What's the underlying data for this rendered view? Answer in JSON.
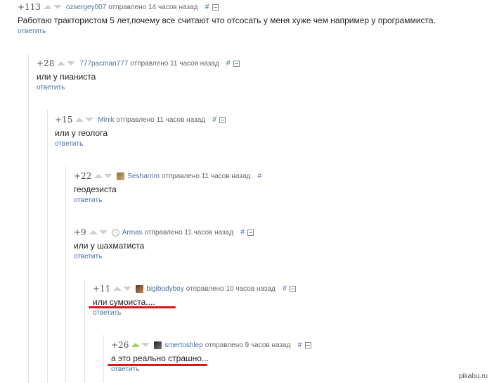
{
  "comments": [
    {
      "score": "+113",
      "author": "ozsergey007",
      "sent": "отправлено 14 часов назад",
      "hash": "#",
      "text": "Работаю трактористом 5 лет,почему все считают что отсосать у меня хуже чем например у программиста.",
      "reply": "ответить"
    },
    {
      "score": "+28",
      "author": "777pacman777",
      "sent": "отправлено 11 часов назад",
      "hash": "#",
      "text": "или у пианиста",
      "reply": "ответить"
    },
    {
      "score": "+15",
      "author": "Minik",
      "sent": "отправлено 11 часов назад",
      "hash": "#",
      "text": "или у геолога",
      "reply": "ответить"
    },
    {
      "score": "+22",
      "author": "Sesharrim",
      "sent": "отправлено 11 часов назад",
      "hash": "#",
      "text": "геодезиста",
      "reply": "ответить"
    },
    {
      "score": "+9",
      "author": "Armas",
      "sent": "отправлено 11 часов назад",
      "hash": "#",
      "text": "или у шахматиста",
      "reply": "ответить"
    },
    {
      "score": "+11",
      "author": "bigibodyboy",
      "sent": "отправлено 10 часов назад",
      "hash": "#",
      "text": "или сумоиста....",
      "reply": "ответить"
    },
    {
      "score": "+26",
      "author": "smertoshlep",
      "sent": "отправлено 9 часов назад",
      "hash": "#",
      "text": "а это реально страшно...",
      "reply": "ответить"
    }
  ],
  "watermark": "pikabu.ru",
  "colors": {
    "link": "#4b73a3",
    "upvote_active": "#9bd34a",
    "vote_inactive": "#cfcfcf",
    "highlight": "#e01616"
  }
}
